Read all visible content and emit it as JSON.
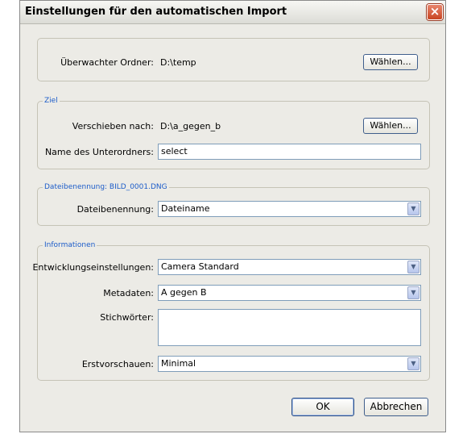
{
  "dialog": {
    "title": "Einstellungen für den automatischen Import",
    "close_glyph": "×"
  },
  "watched": {
    "label": "Überwachter Ordner:",
    "value": "D:\\temp",
    "choose_label": "Wählen..."
  },
  "target": {
    "legend": "Ziel",
    "move_label": "Verschieben nach:",
    "move_value": "D:\\a_gegen_b",
    "choose_label": "Wählen...",
    "subfolder_label": "Name des Unterordners:",
    "subfolder_value": "select"
  },
  "naming": {
    "legend": "Dateibenennung: BILD_0001.DNG",
    "label": "Dateibenennung:",
    "value": "Dateiname"
  },
  "info": {
    "legend": "Informationen",
    "dev_label": "Entwicklungseinstellungen:",
    "dev_value": "Camera Standard",
    "meta_label": "Metadaten:",
    "meta_value": "A gegen B",
    "keywords_label": "Stichwörter:",
    "keywords_value": "",
    "preview_label": "Erstvorschauen:",
    "preview_value": "Minimal"
  },
  "buttons": {
    "ok": "OK",
    "cancel": "Abbrechen"
  },
  "icons": {
    "dropdown": "▼"
  },
  "colors": {
    "legend_text": "#1c5cc9",
    "close_button": "#c84522",
    "dialog_bg": "#ecebe6"
  }
}
